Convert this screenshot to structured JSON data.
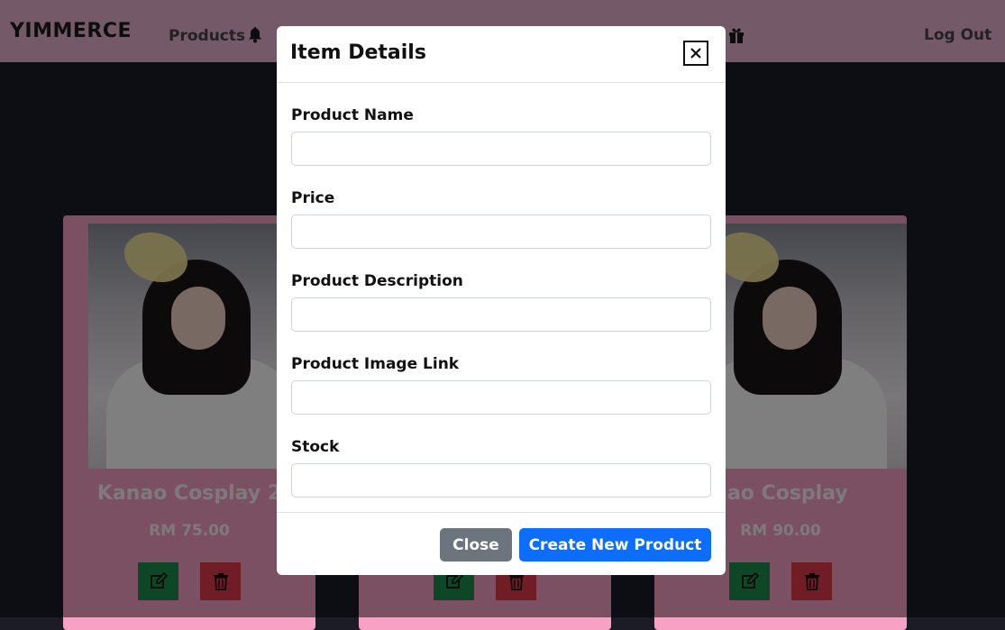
{
  "navbar": {
    "brand": "YIMMERCE",
    "products_label": "Products",
    "logout_label": "Log Out",
    "icons": [
      "bell-icon",
      "gift-icon"
    ]
  },
  "cards": [
    {
      "title": "Kanao Cosplay 2",
      "price": "RM 75.00"
    },
    {
      "title": "",
      "price": ""
    },
    {
      "title": "nao Cosplay",
      "price": "RM 90.00"
    }
  ],
  "modal": {
    "title": "Item Details",
    "fields": [
      {
        "label": "Product Name",
        "value": ""
      },
      {
        "label": "Price",
        "value": ""
      },
      {
        "label": "Product Description",
        "value": ""
      },
      {
        "label": "Product Image Link",
        "value": ""
      },
      {
        "label": "Stock",
        "value": ""
      }
    ],
    "close_label": "Close",
    "create_label": "Create New Product"
  },
  "colors": {
    "navbar": "#e8b4d2",
    "card": "#f7a1c4",
    "edit_button": "#1b8f4a",
    "delete_button": "#e03a4a",
    "primary": "#0d6efd",
    "secondary": "#6c757d"
  }
}
